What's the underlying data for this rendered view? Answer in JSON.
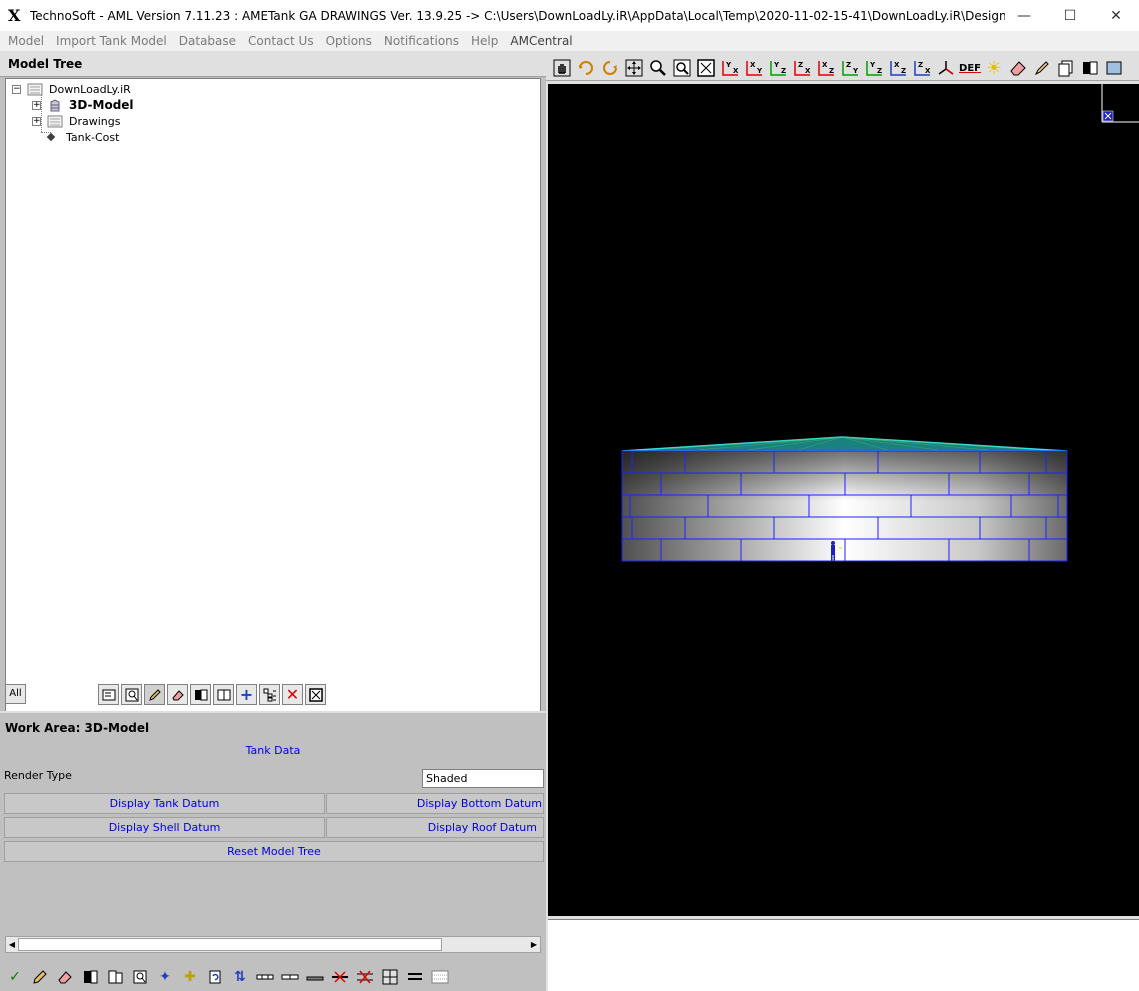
{
  "window": {
    "title": "TechnoSoft - AML Version 7.11.23 : AMETank GA DRAWINGS Ver. 13.9.25 -> C:\\Users\\DownLoadLy.iR\\AppData\\Local\\Temp\\2020-11-02-15-41\\DownLoadLy.iR\\Design Details\\Models\\...",
    "app_icon": "X",
    "minimize": "—",
    "maximize": "☐",
    "close": "✕"
  },
  "menu": [
    "Model",
    "Import Tank Model",
    "Database",
    "Contact Us",
    "Options",
    "Notifications",
    "Help",
    "AMCentral"
  ],
  "tree": {
    "header": "Model Tree",
    "nodes": [
      {
        "label": "DownLoadLy.iR",
        "expander": "−",
        "bold": false
      },
      {
        "label": "3D-Model",
        "expander": "+",
        "bold": true
      },
      {
        "label": "Drawings",
        "expander": "+",
        "bold": false
      },
      {
        "label": "Tank-Cost",
        "expander": "",
        "bold": false
      }
    ],
    "filter_label": "All"
  },
  "work_area": {
    "title": "Work Area: 3D-Model",
    "tank_data_link": "Tank Data",
    "render_label": "Render Type",
    "render_value": "Shaded",
    "buttons": {
      "tank_datum": "Display Tank Datum",
      "bottom_datum": "Display Bottom Datum",
      "shell_datum": "Display Shell Datum",
      "roof_datum": "Display Roof Datum",
      "reset_tree": "Reset Model Tree"
    }
  },
  "viewer": {
    "def_label": "DEF"
  }
}
